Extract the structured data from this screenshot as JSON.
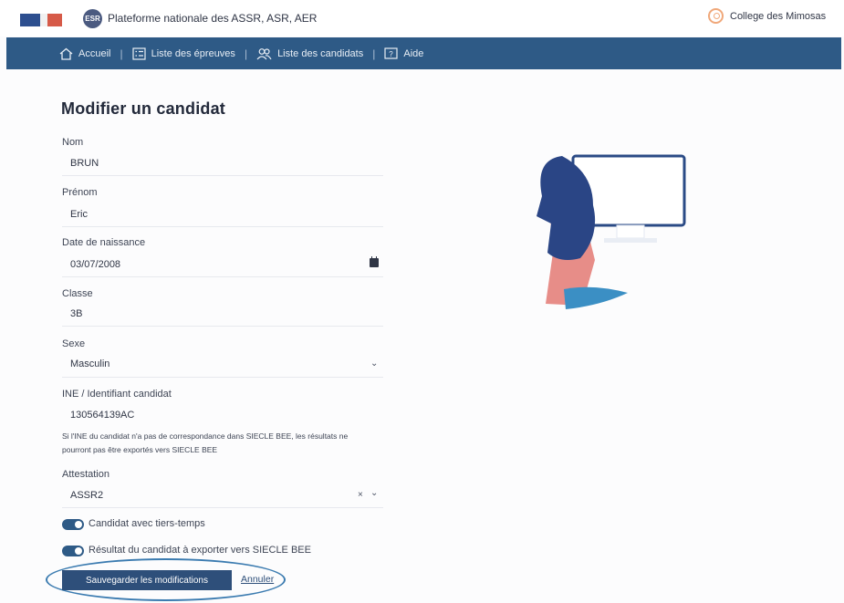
{
  "header": {
    "platform_title": "Plateforme nationale des ASSR, ASR, AER",
    "logo_text": "ESR",
    "school_name": "College des Mimosas"
  },
  "nav": {
    "items": [
      {
        "label": "Accueil",
        "icon": "home-icon"
      },
      {
        "label": "Liste des épreuves",
        "icon": "checklist-icon"
      },
      {
        "label": "Liste des candidats",
        "icon": "users-icon"
      },
      {
        "label": "Aide",
        "icon": "help-icon"
      }
    ]
  },
  "form": {
    "title": "Modifier un candidat",
    "nom": {
      "label": "Nom",
      "value": "BRUN"
    },
    "prenom": {
      "label": "Prénom",
      "value": "Eric"
    },
    "naissance": {
      "label": "Date de naissance",
      "value": "03/07/2008"
    },
    "classe": {
      "label": "Classe",
      "value": "3B"
    },
    "sexe": {
      "label": "Sexe",
      "value": "Masculin"
    },
    "ine": {
      "label": "INE / Identifiant candidat",
      "value": "130564139AC",
      "help": "Si l'INE du candidat n'a pas de correspondance dans SIECLE BEE, les résultats ne pourront pas être exportés vers SIECLE BEE"
    },
    "attestation": {
      "label": "Attestation",
      "value": "ASSR2",
      "clear_symbol": "×"
    },
    "tiers_temps": {
      "label": "Candidat avec tiers-temps",
      "checked": true
    },
    "export": {
      "label": "Résultat du candidat à exporter vers SIECLE BEE",
      "checked": true
    },
    "save_label": "Sauvegarder les modifications",
    "cancel_label": "Annuler"
  },
  "colors": {
    "nav_bg": "#2e5a86",
    "button_bg": "#2e4f7a",
    "accent_orange": "#f0a87a",
    "annotation_ellipse": "#3b7bb0"
  }
}
